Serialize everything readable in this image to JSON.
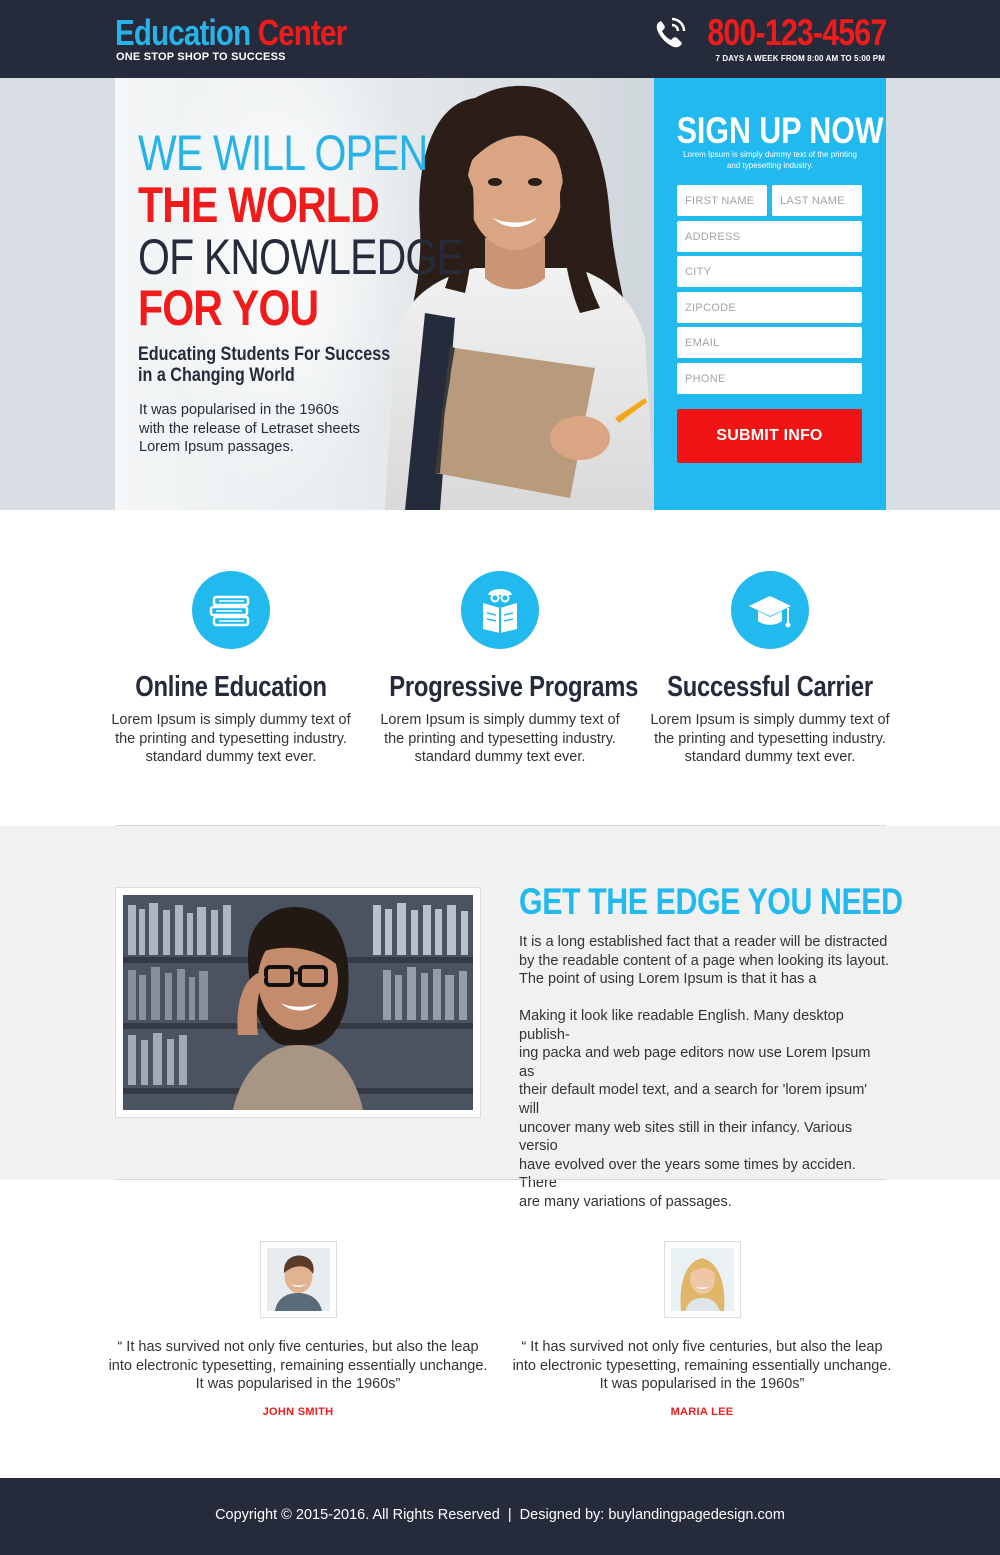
{
  "header": {
    "brand_part1": "Education",
    "brand_part2": "Center",
    "tagline": "ONE STOP SHOP TO SUCCESS",
    "phone": "800-123-4567",
    "hours": "7 DAYS A WEEK FROM 8:00 AM TO 5:00 PM"
  },
  "hero": {
    "line1": "WE WILL OPEN",
    "line2": "THE WORLD",
    "line3": "OF KNOWLEDGE",
    "line4": "FOR YOU",
    "subtitle_line1": "Educating Students For Success",
    "subtitle_line2": "in a Changing World",
    "desc_line1": "It was popularised in the 1960s",
    "desc_line2": "with the release of Letraset sheets",
    "desc_line3": "Lorem Ipsum passages."
  },
  "form": {
    "title": "SIGN UP NOW",
    "subtitle_line1": "Lorem Ipsum is simply dummy text of the printing",
    "subtitle_line2": "and typesetting industry.",
    "first_name_placeholder": "FIRST NAME",
    "last_name_placeholder": "LAST NAME",
    "address_placeholder": "ADDRESS",
    "city_placeholder": "CITY",
    "zipcode_placeholder": "ZIPCODE",
    "email_placeholder": "EMAIL",
    "phone_placeholder": "PHONE",
    "submit_label": "SUBMIT INFO"
  },
  "features": [
    {
      "icon": "books-icon",
      "title": "Online Education",
      "line1": "Lorem Ipsum is simply dummy text of",
      "line2": "the printing and typesetting industry.",
      "line3": "standard dummy text ever."
    },
    {
      "icon": "reader-icon",
      "title": "Progressive Programs",
      "line1": "Lorem Ipsum is simply dummy text of",
      "line2": "the printing and typesetting industry.",
      "line3": "standard dummy text ever."
    },
    {
      "icon": "graduation-cap-icon",
      "title": "Successful Carrier",
      "line1": "Lorem Ipsum is simply dummy text of",
      "line2": "the printing and typesetting industry.",
      "line3": "standard dummy text ever."
    }
  ],
  "edge": {
    "title": "GET THE EDGE YOU NEED",
    "p1_line1": "It is a long established fact that a reader will be distracted",
    "p1_line2": "by the readable content of a page when looking its layout.",
    "p1_line3": "The point of using Lorem Ipsum is that it has a",
    "p2_line1": "Making it look like readable English. Many desktop publish-",
    "p2_line2": "ing packa and web page editors now use Lorem Ipsum as",
    "p2_line3": "their default model text, and a search for 'lorem ipsum' will",
    "p2_line4": "uncover many web sites still in their infancy. Various versio",
    "p2_line5": "have evolved over the years some times by acciden. There",
    "p2_line6": "are many variations of passages."
  },
  "testimonials": [
    {
      "line1": "“ It has survived not only five centuries, but also the leap",
      "line2": "into electronic typesetting, remaining essentially unchange.",
      "line3": "It was popularised in the 1960s”",
      "name": "JOHN SMITH"
    },
    {
      "line1": "“ It has survived not only five centuries, but also the leap",
      "line2": "into electronic typesetting, remaining essentially unchange.",
      "line3": "It was popularised in the 1960s”",
      "name": "MARIA LEE"
    }
  ],
  "footer": {
    "text": "Copyright © 2015-2016. All Rights Reserved  |  Designed by: buylandingpagedesign.com"
  },
  "colors": {
    "navy": "#262b3c",
    "blue": "#22b9ee",
    "red": "#f01c1c"
  }
}
